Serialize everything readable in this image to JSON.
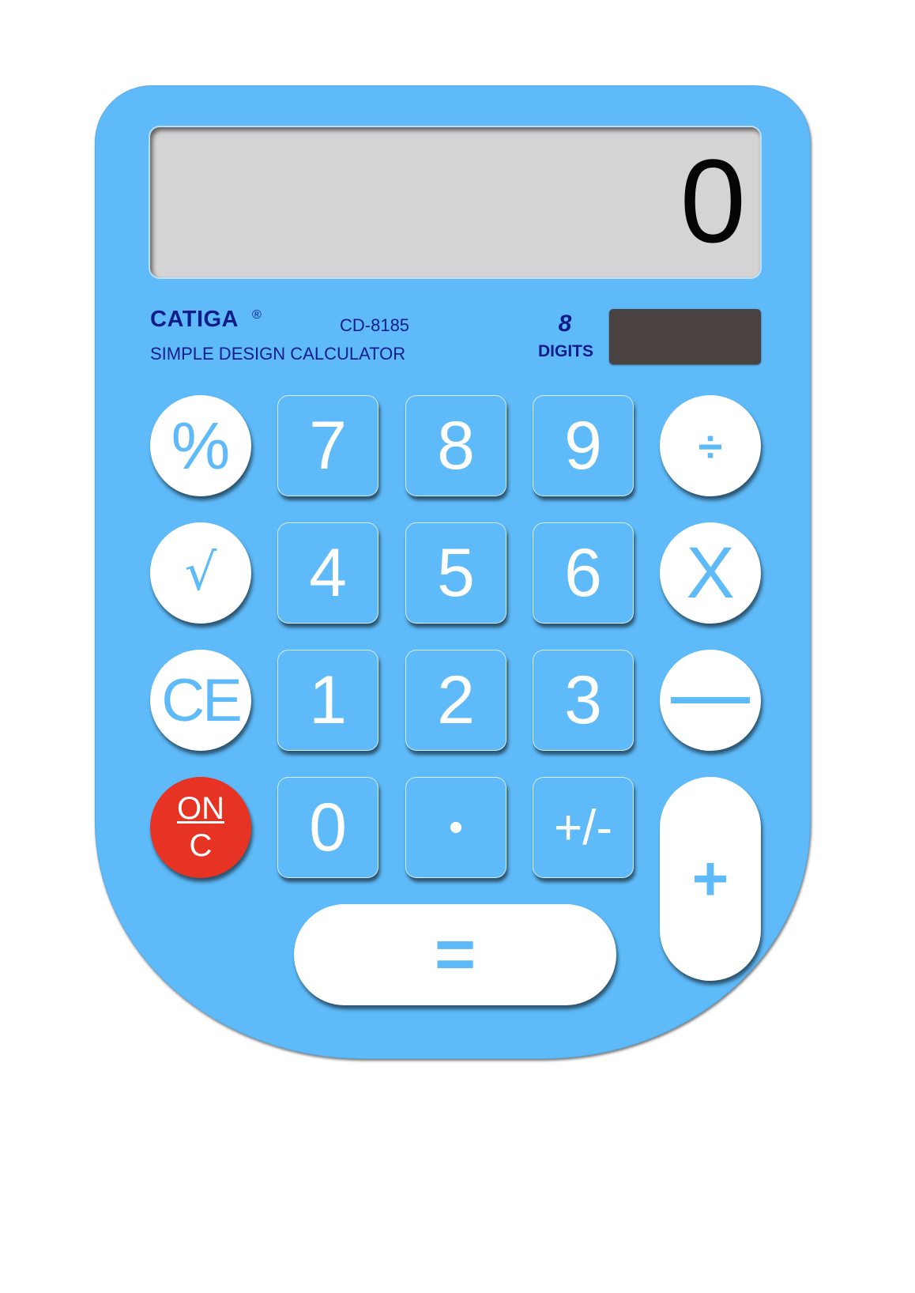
{
  "calculator": {
    "display_value": "0",
    "brand": "CATIGA",
    "registered_mark": "®",
    "model": "CD-8185",
    "subtitle": "SIMPLE DESIGN CALCULATOR",
    "digits_number": "8",
    "digits_label": "DIGITS"
  },
  "keys": {
    "percent": "%",
    "seven": "7",
    "eight": "8",
    "nine": "9",
    "divide": "÷",
    "sqrt": "√",
    "four": "4",
    "five": "5",
    "six": "6",
    "multiply": "X",
    "ce": "CE",
    "one": "1",
    "two": "2",
    "three": "3",
    "on": "ON",
    "c": "C",
    "zero": "0",
    "decimal": "•",
    "plus_minus": "+/-",
    "plus": "+",
    "equals": "="
  },
  "colors": {
    "body": "#5ebaf8",
    "display": "#d4d4d4",
    "text_brand": "#0f1d8a",
    "on_key": "#e63323",
    "solar_panel": "#4a4141",
    "white_key": "#ffffff"
  }
}
